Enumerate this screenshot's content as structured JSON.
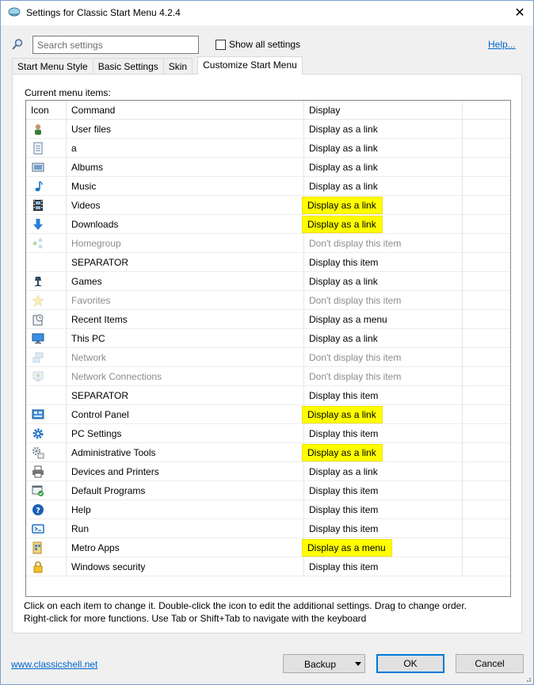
{
  "window": {
    "title": "Settings for Classic Start Menu 4.2.4",
    "close_label": "✕"
  },
  "search": {
    "placeholder": "Search settings"
  },
  "show_all": {
    "label": "Show all settings",
    "checked": false
  },
  "help": {
    "label": "Help..."
  },
  "tabs": [
    {
      "label": "Start Menu Style",
      "active": false
    },
    {
      "label": "Basic Settings",
      "active": false
    },
    {
      "label": "Skin",
      "active": false
    },
    {
      "label": "Customize Start Menu",
      "active": true
    }
  ],
  "list": {
    "label": "Current menu items:",
    "headers": {
      "icon": "Icon",
      "command": "Command",
      "display": "Display"
    },
    "rows": [
      {
        "icon": "user-files-icon",
        "command": "User files",
        "display": "Display as a link",
        "muted": false,
        "highlight": false
      },
      {
        "icon": "document-icon",
        "command": "a",
        "display": "Display as a link",
        "muted": false,
        "highlight": false
      },
      {
        "icon": "albums-icon",
        "command": "Albums",
        "display": "Display as a link",
        "muted": false,
        "highlight": false
      },
      {
        "icon": "music-note-icon",
        "command": "Music",
        "display": "Display as a link",
        "muted": false,
        "highlight": false
      },
      {
        "icon": "film-strip-icon",
        "command": "Videos",
        "display": "Display as a link",
        "muted": false,
        "highlight": true
      },
      {
        "icon": "download-arrow-icon",
        "command": "Downloads",
        "display": "Display as a link",
        "muted": false,
        "highlight": true
      },
      {
        "icon": "homegroup-icon",
        "command": "Homegroup",
        "display": "Don't display this item",
        "muted": true,
        "highlight": false
      },
      {
        "icon": "",
        "command": "SEPARATOR",
        "display": "Display this item",
        "muted": false,
        "highlight": false
      },
      {
        "icon": "games-icon",
        "command": "Games",
        "display": "Display as a link",
        "muted": false,
        "highlight": false
      },
      {
        "icon": "star-icon",
        "command": "Favorites",
        "display": "Don't display this item",
        "muted": true,
        "highlight": false
      },
      {
        "icon": "recent-items-icon",
        "command": "Recent Items",
        "display": "Display as a menu",
        "muted": false,
        "highlight": false
      },
      {
        "icon": "monitor-icon",
        "command": "This PC",
        "display": "Display as a link",
        "muted": false,
        "highlight": false
      },
      {
        "icon": "network-icon",
        "command": "Network",
        "display": "Don't display this item",
        "muted": true,
        "highlight": false
      },
      {
        "icon": "network-connections-icon",
        "command": "Network Connections",
        "display": "Don't display this item",
        "muted": true,
        "highlight": false
      },
      {
        "icon": "",
        "command": "SEPARATOR",
        "display": "Display this item",
        "muted": false,
        "highlight": false
      },
      {
        "icon": "control-panel-icon",
        "command": "Control Panel",
        "display": "Display as a link",
        "muted": false,
        "highlight": true
      },
      {
        "icon": "gear-icon",
        "command": "PC Settings",
        "display": "Display this item",
        "muted": false,
        "highlight": false
      },
      {
        "icon": "admin-tools-icon",
        "command": "Administrative Tools",
        "display": "Display as a link",
        "muted": false,
        "highlight": true
      },
      {
        "icon": "printer-icon",
        "command": "Devices and Printers",
        "display": "Display as a link",
        "muted": false,
        "highlight": false
      },
      {
        "icon": "default-programs-icon",
        "command": "Default Programs",
        "display": "Display this item",
        "muted": false,
        "highlight": false
      },
      {
        "icon": "help-icon",
        "command": "Help",
        "display": "Display this item",
        "muted": false,
        "highlight": false
      },
      {
        "icon": "run-icon",
        "command": "Run",
        "display": "Display this item",
        "muted": false,
        "highlight": false
      },
      {
        "icon": "metro-apps-icon",
        "command": "Metro Apps",
        "display": "Display as a menu",
        "muted": false,
        "highlight": true
      },
      {
        "icon": "lock-icon",
        "command": "Windows security",
        "display": "Display this item",
        "muted": false,
        "highlight": false
      }
    ]
  },
  "info": {
    "line1": "Click on each item to change it. Double-click the icon to edit the additional settings. Drag to change order.",
    "line2": "Right-click for more functions. Use Tab or Shift+Tab to navigate with the keyboard"
  },
  "footer": {
    "link": "www.classicshell.net",
    "backup_label": "Backup",
    "ok_label": "OK",
    "cancel_label": "Cancel"
  },
  "colors": {
    "highlight": "#ffff00",
    "link": "#0066cc",
    "accent": "#0078d7",
    "muted_text": "#8c8c8c"
  }
}
